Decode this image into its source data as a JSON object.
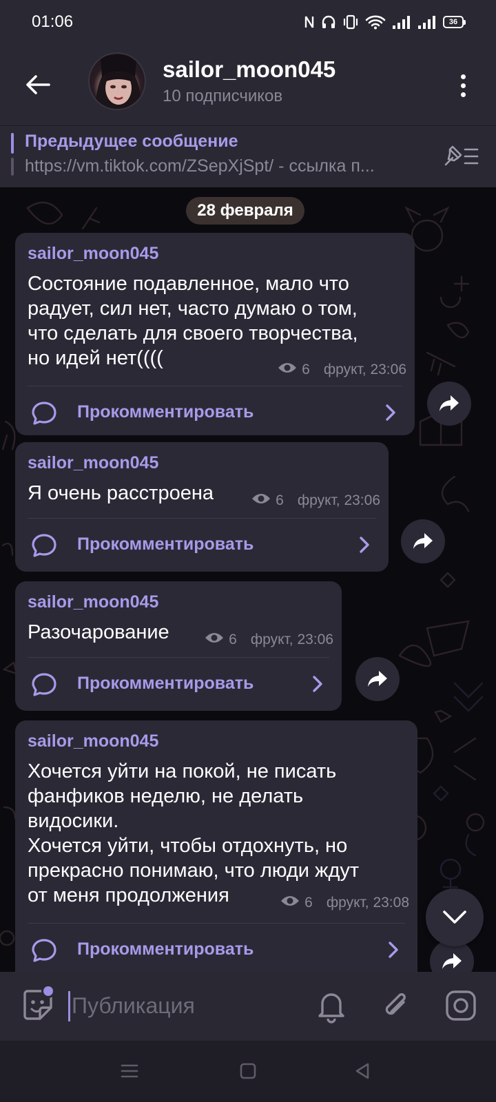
{
  "status_bar": {
    "time": "01:06",
    "battery": "36"
  },
  "header": {
    "channel_name": "sailor_moon045",
    "subscribers": "10 подписчиков"
  },
  "pinned": {
    "title": "Предыдущее сообщение",
    "text": "https://vm.tiktok.com/ZSepXjSpt/ - ссылка п..."
  },
  "date_label": "28 февраля",
  "comment_label": "Прокомментировать",
  "messages": [
    {
      "author": "sailor_moon045",
      "text": "Состояние подавленное, мало что\nрадует, сил нет, часто думаю о том,\nчто сделать для своего творчества,\nно идей нет((((",
      "views": "6",
      "signature": "фрукт, 23:06"
    },
    {
      "author": "sailor_moon045",
      "text": "Я очень расстроена",
      "views": "6",
      "signature": "фрукт, 23:06"
    },
    {
      "author": "sailor_moon045",
      "text": "Разочарование",
      "views": "6",
      "signature": "фрукт, 23:06"
    },
    {
      "author": "sailor_moon045",
      "text": "Хочется уйти на покой, не писать\nфанфиков неделю, не делать\nвидосики.\nХочется уйти, чтобы отдохнуть, но\nпрекрасно понимаю, что люди ждут\nот меня продолжения",
      "views": "6",
      "signature": "фрукт, 23:08"
    }
  ],
  "input": {
    "placeholder": "Публикация",
    "value": ""
  },
  "colors": {
    "accent": "#a79be9",
    "bubble": "#2b2936",
    "bar": "#2a2833",
    "background": "#0b0a0f"
  },
  "icons": {
    "status": [
      "nfc-icon",
      "headphones-icon",
      "vibrate-icon",
      "wifi-icon",
      "signal-icon",
      "battery-icon"
    ],
    "header": [
      "back-arrow-icon",
      "more-vert-icon"
    ],
    "pinned": "unpin-list-icon",
    "message": [
      "eye-icon",
      "comment-bubble-icon",
      "chevron-right-icon",
      "share-arrow-icon"
    ],
    "input": [
      "sticker-icon",
      "bell-icon",
      "paperclip-icon",
      "instagram-icon"
    ],
    "nav": [
      "menu-icon",
      "home-square-icon",
      "back-triangle-icon"
    ]
  }
}
